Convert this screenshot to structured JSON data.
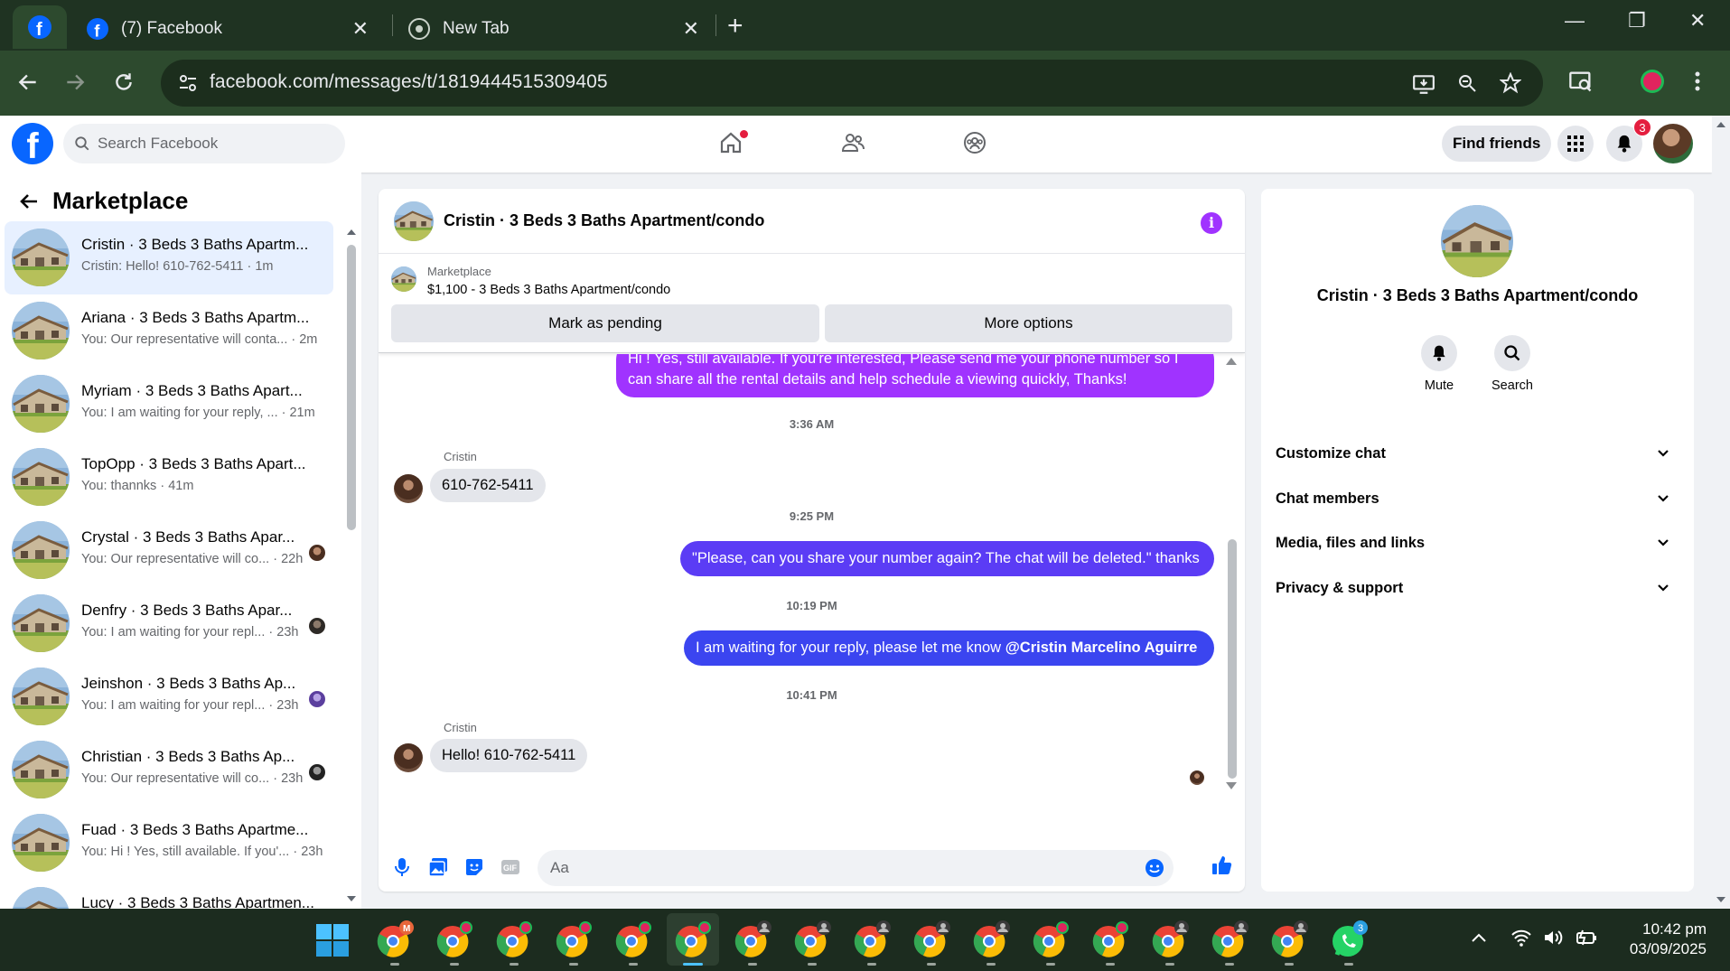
{
  "browser": {
    "tabs": [
      {
        "title": "(7) Facebook"
      },
      {
        "title": "New Tab"
      }
    ],
    "url": "facebook.com/messages/t/1819444515309405"
  },
  "header": {
    "logo": "f",
    "search_placeholder": "Search Facebook",
    "find_friends": "Find friends",
    "notification_count": "3"
  },
  "left": {
    "title": "Marketplace",
    "conversations": [
      {
        "name": "Cristin · 3 Beds 3 Baths Apartm...",
        "preview": "Cristin: Hello! 610-762-5411 · 1m",
        "selected": true
      },
      {
        "name": "Ariana · 3 Beds 3 Baths Apartm...",
        "preview": "You: Our representative will conta... · 2m"
      },
      {
        "name": "Myriam · 3 Beds 3 Baths Apart...",
        "preview": "You: I am waiting for your reply, ... · 21m"
      },
      {
        "name": "TopOpp · 3 Beds 3 Baths Apart...",
        "preview": "You: thannks · 41m"
      },
      {
        "name": "Crystal · 3 Beds 3 Baths Apar...",
        "preview": "You: Our representative will co... · 22h"
      },
      {
        "name": "Denfry · 3 Beds 3 Baths Apar...",
        "preview": "You: I am waiting for your repl... · 23h"
      },
      {
        "name": "Jeinshon · 3 Beds 3 Baths Ap...",
        "preview": "You: I am waiting for your repl... · 23h"
      },
      {
        "name": "Christian · 3 Beds 3 Baths Ap...",
        "preview": "You: Our representative will co... · 23h"
      },
      {
        "name": "Fuad · 3 Beds 3 Baths Apartme...",
        "preview": "You: Hi ! Yes, still available. If you'... · 23h"
      },
      {
        "name": "Lucy · 3 Beds 3 Baths Apartmen...",
        "preview": ""
      }
    ]
  },
  "chat": {
    "title": "Cristin · 3 Beds 3 Baths Apartment/condo",
    "marketplace_label": "Marketplace",
    "listing": "$1,100 - 3 Beds 3 Baths Apartment/condo",
    "mark_pending": "Mark as pending",
    "more_options": "More options",
    "messages": {
      "out1": "Hi ! Yes, still available. If you're interested, Please send me your phone number so I can share all the rental details and help schedule a viewing quickly, Thanks!",
      "ts1": "3:36 AM",
      "sender1": "Cristin",
      "in1": "610-762-5411",
      "ts2": "9:25 PM",
      "out2": "\"Please, can you share your number again? The chat will be deleted.\" thanks",
      "ts3": "10:19 PM",
      "out3_text": "I am waiting for your reply, please let me know ",
      "out3_mention": "@Cristin Marcelino Aguirre",
      "ts4": "10:41 PM",
      "sender2": "Cristin",
      "in2": "Hello! 610-762-5411"
    },
    "composer_placeholder": "Aa"
  },
  "right": {
    "name": "Cristin · 3 Beds 3 Baths Apartment/condo",
    "mute": "Mute",
    "search": "Search",
    "sections": [
      "Customize chat",
      "Chat members",
      "Media, files and links",
      "Privacy & support"
    ]
  },
  "taskbar": {
    "time": "10:42 pm",
    "date": "03/09/2025",
    "mail_badge": "M",
    "whatsapp_badge": "3"
  },
  "colors": {
    "fb_blue": "#0866ff",
    "bubble_purple": "#a033ff",
    "bubble_indigo": "#5b3cf5",
    "bubble_blue": "#3b45f0"
  }
}
